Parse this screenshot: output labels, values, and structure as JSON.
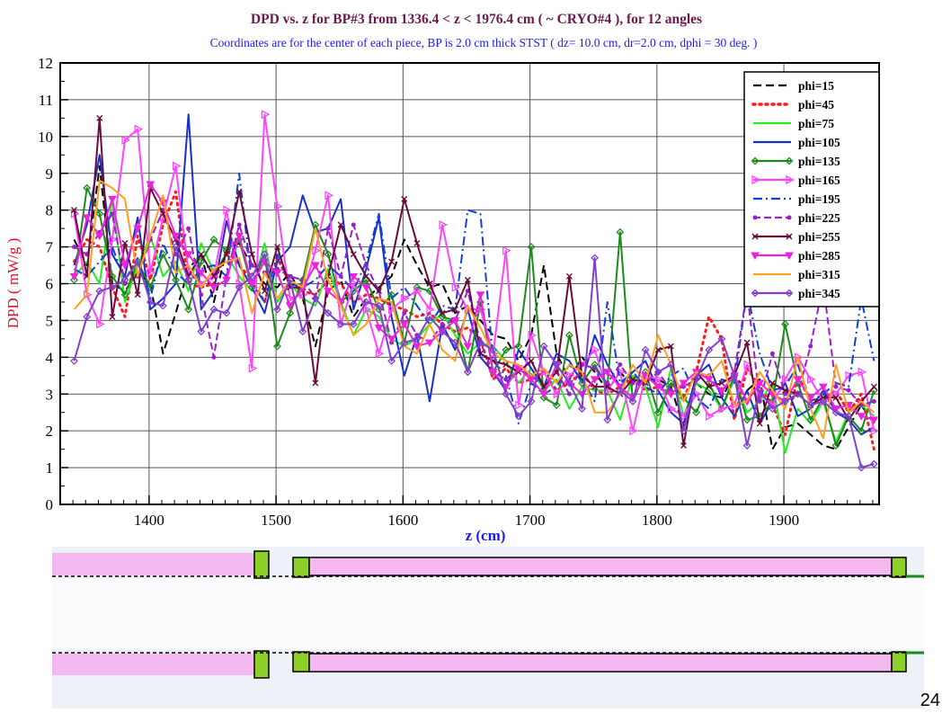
{
  "slide_number": "24",
  "colors": {
    "title": "#6b1a4a",
    "subtitle": "#1a1aff",
    "ylabel": "#e0102a",
    "xlabel": "#1a1aff",
    "geometry_pink": "#f4b8f0",
    "geometry_green": "#8fcf2a",
    "geometry_bg": "#eef1f7"
  },
  "chart_data": {
    "type": "line",
    "title": "DPD vs. z   for  BP#3  from 1336.4 < z < 1976.4 cm ( ~ CRYO#4 ), for 12 angles",
    "subtitle": "Coordinates are for the center of each piece, BP is 2.0 cm thick STST  ( dz= 10.0 cm, dr=2.0 cm, dphi = 30 deg. )",
    "xlabel": "z (cm)",
    "ylabel": "DPD ( mW/g )",
    "xlim": [
      1330,
      1975
    ],
    "ylim": [
      0,
      12
    ],
    "xticks": [
      1400,
      1500,
      1600,
      1700,
      1800,
      1900
    ],
    "yticks": [
      0,
      1,
      2,
      3,
      4,
      5,
      6,
      7,
      8,
      9,
      10,
      11,
      12
    ],
    "grid": true,
    "legend_position": "top-right",
    "x": [
      1341,
      1351,
      1361,
      1371,
      1381,
      1391,
      1401,
      1411,
      1421,
      1431,
      1441,
      1451,
      1461,
      1471,
      1481,
      1491,
      1501,
      1511,
      1521,
      1531,
      1541,
      1551,
      1561,
      1571,
      1581,
      1591,
      1601,
      1611,
      1621,
      1631,
      1641,
      1651,
      1661,
      1671,
      1681,
      1691,
      1701,
      1711,
      1721,
      1731,
      1741,
      1751,
      1761,
      1771,
      1781,
      1791,
      1801,
      1811,
      1821,
      1831,
      1841,
      1851,
      1861,
      1871,
      1881,
      1891,
      1901,
      1911,
      1921,
      1931,
      1941,
      1951,
      1961,
      1971
    ],
    "series": [
      {
        "name": "phi=15",
        "color": "#000000",
        "dash": "9,5",
        "marker": "none",
        "values": [
          7.2,
          6.5,
          9.2,
          6.0,
          5.8,
          6.3,
          6.0,
          4.1,
          5.2,
          6.4,
          6.8,
          5.5,
          6.9,
          7.1,
          6.5,
          6.0,
          5.9,
          6.3,
          5.6,
          4.3,
          5.8,
          6.1,
          5.1,
          5.6,
          5.9,
          6.2,
          7.2,
          6.5,
          5.9,
          6.0,
          5.2,
          5.4,
          5.0,
          4.6,
          4.5,
          3.9,
          4.6,
          6.5,
          4.1,
          3.4,
          4.0,
          3.6,
          3.1,
          3.6,
          3.2,
          3.4,
          3.4,
          3.2,
          2.1,
          3.3,
          3.0,
          2.9,
          3.5,
          3.1,
          3.4,
          1.5,
          2.1,
          2.2,
          1.9,
          1.6,
          1.5,
          2.1,
          2.7,
          2.2
        ]
      },
      {
        "name": "phi=45",
        "color": "#ff1a1a",
        "dash": "2,5",
        "marker": "none",
        "values": [
          6.6,
          7.2,
          7.0,
          5.9,
          5.1,
          7.3,
          6.1,
          7.6,
          8.5,
          6.0,
          5.9,
          6.0,
          6.9,
          6.5,
          6.1,
          5.5,
          6.7,
          6.0,
          5.8,
          5.7,
          6.1,
          6.0,
          5.5,
          5.7,
          5.6,
          5.4,
          5.3,
          5.1,
          5.2,
          4.9,
          4.7,
          4.8,
          4.5,
          3.4,
          3.7,
          3.3,
          3.4,
          3.6,
          3.1,
          3.3,
          3.6,
          3.1,
          3.0,
          3.2,
          3.4,
          3.1,
          3.2,
          3.3,
          2.9,
          3.6,
          5.1,
          4.5,
          2.3,
          3.7,
          3.2,
          2.7,
          1.9,
          3.5,
          2.8,
          2.9,
          3.1,
          2.5,
          3.0,
          1.5
        ]
      },
      {
        "name": "phi=75",
        "color": "#22ee22",
        "dash": "",
        "marker": "none",
        "values": [
          6.2,
          6.6,
          6.0,
          8.3,
          5.5,
          6.5,
          7.3,
          6.2,
          6.6,
          5.8,
          7.1,
          6.3,
          6.8,
          6.2,
          5.8,
          7.1,
          5.5,
          6.0,
          5.6,
          5.4,
          6.4,
          5.5,
          4.6,
          5.3,
          5.1,
          4.5,
          4.3,
          4.5,
          4.9,
          5.2,
          4.6,
          4.1,
          4.4,
          4.3,
          3.9,
          3.3,
          3.7,
          3.1,
          3.4,
          2.6,
          3.2,
          3.1,
          3.1,
          2.3,
          3.5,
          3.2,
          2.1,
          3.7,
          2.4,
          3.3,
          3.1,
          2.6,
          3.4,
          2.5,
          2.8,
          3.3,
          1.4,
          2.6,
          2.2,
          2.8,
          1.7,
          2.5,
          2.7,
          2.4
        ]
      },
      {
        "name": "phi=105",
        "color": "#1530cc",
        "dash": "",
        "marker": "none",
        "values": [
          6.5,
          7.6,
          9.5,
          6.8,
          6.2,
          7.8,
          5.3,
          5.6,
          6.0,
          10.6,
          5.3,
          5.8,
          7.7,
          6.5,
          5.9,
          5.2,
          6.6,
          7.0,
          8.4,
          7.4,
          7.5,
          8.3,
          5.3,
          6.4,
          7.8,
          5.1,
          3.5,
          4.6,
          2.8,
          4.9,
          4.2,
          5.3,
          4.0,
          3.6,
          3.1,
          4.2,
          3.7,
          3.2,
          4.1,
          3.9,
          3.3,
          4.6,
          3.8,
          3.2,
          3.6,
          3.9,
          3.1,
          2.5,
          2.2,
          3.5,
          3.8,
          2.9,
          2.4,
          3.1,
          2.2,
          2.8,
          3.3,
          2.4,
          2.6,
          3.1,
          2.5,
          2.3,
          1.9,
          2.1
        ]
      },
      {
        "name": "phi=135",
        "color": "#1d8a1d",
        "dash": "",
        "marker": "diamond",
        "values": [
          6.1,
          8.6,
          7.9,
          6.2,
          5.7,
          6.6,
          5.9,
          6.8,
          6.1,
          5.3,
          6.6,
          7.2,
          6.9,
          7.2,
          5.9,
          6.8,
          4.3,
          5.2,
          6.1,
          7.6,
          6.8,
          5.5,
          5.8,
          6.1,
          5.3,
          5.7,
          4.4,
          5.9,
          5.8,
          5.1,
          5.0,
          3.6,
          5.5,
          3.6,
          4.2,
          4.3,
          7.0,
          2.9,
          2.7,
          4.6,
          3.3,
          3.8,
          3.2,
          7.4,
          2.8,
          3.6,
          2.5,
          3.3,
          2.9,
          2.5,
          3.3,
          2.6,
          3.5,
          2.3,
          2.4,
          2.8,
          4.9,
          3.3,
          2.3,
          2.9,
          1.6,
          2.4,
          2.0,
          3.1
        ]
      },
      {
        "name": "phi=165",
        "color": "#ff44ff",
        "dash": "",
        "marker": "tri",
        "values": [
          7.9,
          5.7,
          4.9,
          7.2,
          9.9,
          10.2,
          6.3,
          7.8,
          9.2,
          6.3,
          6.0,
          6.2,
          8.0,
          6.0,
          3.7,
          10.6,
          8.1,
          5.6,
          5.7,
          6.9,
          8.4,
          4.9,
          6.0,
          5.3,
          4.1,
          5.3,
          5.6,
          5.8,
          5.3,
          7.6,
          5.9,
          5.3,
          5.3,
          4.1,
          6.9,
          2.7,
          4.6,
          3.6,
          3.0,
          3.5,
          3.8,
          4.2,
          3.1,
          3.6,
          2.0,
          3.5,
          3.4,
          2.6,
          2.4,
          3.0,
          2.4,
          2.6,
          2.7,
          3.8,
          3.0,
          2.7,
          3.4,
          4.0,
          3.4,
          2.8,
          3.0,
          3.5,
          3.6,
          2.0
        ]
      },
      {
        "name": "phi=195",
        "color": "#1040dd",
        "dash": "10,4,2,4",
        "marker": "none",
        "values": [
          6.4,
          6.2,
          6.6,
          7.0,
          6.1,
          6.7,
          5.6,
          7.1,
          6.3,
          6.0,
          6.4,
          6.5,
          6.2,
          9.0,
          6.0,
          5.5,
          6.8,
          6.0,
          5.9,
          6.1,
          6.5,
          6.2,
          5.8,
          6.6,
          7.9,
          5.6,
          5.9,
          5.4,
          4.9,
          5.4,
          5.3,
          8.0,
          7.9,
          3.9,
          3.5,
          2.2,
          3.3,
          3.0,
          3.2,
          3.8,
          3.4,
          2.8,
          5.5,
          3.3,
          3.6,
          3.2,
          3.0,
          3.5,
          3.7,
          2.9,
          2.6,
          3.4,
          3.3,
          5.8,
          4.1,
          3.1,
          3.2,
          3.8,
          2.8,
          3.0,
          3.3,
          3.2,
          5.6,
          3.9
        ]
      },
      {
        "name": "phi=225",
        "color": "#9a20c8",
        "dash": "8,4",
        "marker": "dot",
        "values": [
          7.0,
          6.8,
          7.4,
          7.9,
          6.0,
          6.2,
          7.2,
          8.0,
          6.8,
          7.5,
          5.7,
          4.0,
          6.2,
          7.6,
          6.5,
          6.3,
          6.4,
          6.2,
          6.1,
          5.6,
          7.5,
          6.2,
          7.6,
          6.5,
          5.8,
          4.4,
          5.2,
          4.6,
          4.4,
          4.9,
          5.0,
          5.8,
          4.4,
          3.6,
          3.4,
          3.7,
          3.5,
          3.2,
          3.6,
          3.0,
          3.8,
          3.7,
          3.3,
          3.8,
          3.3,
          3.3,
          3.6,
          3.1,
          3.2,
          3.4,
          3.5,
          3.0,
          3.6,
          5.8,
          2.8,
          4.1,
          3.0,
          3.0,
          4.3,
          6.0,
          3.2,
          3.1,
          2.7,
          2.8
        ]
      },
      {
        "name": "phi=255",
        "color": "#6a0a3a",
        "dash": "",
        "marker": "x",
        "values": [
          8.0,
          6.2,
          10.5,
          5.1,
          7.1,
          5.7,
          8.6,
          7.9,
          7.2,
          6.2,
          6.8,
          6.2,
          6.8,
          8.5,
          6.8,
          5.8,
          7.0,
          5.9,
          5.9,
          3.3,
          6.2,
          7.6,
          6.8,
          6.2,
          5.8,
          6.6,
          8.3,
          7.1,
          6.0,
          5.2,
          5.3,
          6.1,
          4.1,
          3.9,
          3.8,
          3.6,
          3.9,
          3.2,
          3.6,
          6.2,
          3.5,
          3.2,
          3.2,
          3.0,
          3.4,
          3.3,
          4.2,
          4.3,
          1.6,
          3.6,
          3.2,
          3.3,
          3.5,
          4.4,
          2.2,
          3.3,
          3.1,
          3.0,
          2.7,
          2.9,
          2.9,
          2.3,
          2.8,
          3.2
        ]
      },
      {
        "name": "phi=285",
        "color": "#ee22dd",
        "dash": "",
        "marker": "tridown",
        "values": [
          6.2,
          7.8,
          7.3,
          8.3,
          6.5,
          7.5,
          8.7,
          8.2,
          7.3,
          6.8,
          6.3,
          5.9,
          6.1,
          7.3,
          6.0,
          6.6,
          6.3,
          5.4,
          5.9,
          6.5,
          5.8,
          5.5,
          6.2,
          5.9,
          4.8,
          4.5,
          4.9,
          4.3,
          4.4,
          4.7,
          5.0,
          4.3,
          5.7,
          3.6,
          3.2,
          3.7,
          3.4,
          3.0,
          3.8,
          3.3,
          3.0,
          3.4,
          3.6,
          3.2,
          2.9,
          3.5,
          3.2,
          3.0,
          3.3,
          3.6,
          3.4,
          3.1,
          3.5,
          2.8,
          3.3,
          3.0,
          2.8,
          3.4,
          2.9,
          3.2,
          2.6,
          2.7,
          2.4,
          2.3
        ]
      },
      {
        "name": "phi=315",
        "color": "#ffa020",
        "dash": "",
        "marker": "none",
        "values": [
          5.3,
          5.7,
          8.8,
          8.6,
          8.3,
          6.2,
          7.3,
          8.4,
          6.3,
          6.5,
          5.9,
          6.4,
          6.6,
          6.7,
          5.2,
          6.3,
          5.6,
          6.1,
          5.9,
          7.5,
          6.1,
          5.4,
          4.6,
          4.9,
          5.6,
          5.5,
          4.3,
          4.1,
          4.9,
          4.2,
          3.9,
          5.4,
          4.8,
          4.1,
          3.9,
          3.8,
          3.5,
          3.7,
          3.3,
          3.8,
          3.6,
          2.5,
          2.5,
          3.0,
          3.8,
          3.3,
          4.6,
          3.8,
          2.8,
          3.6,
          3.5,
          3.9,
          2.7,
          2.8,
          3.6,
          3.1,
          2.6,
          4.0,
          2.6,
          1.8,
          3.8,
          2.5,
          2.8,
          2.5
        ]
      },
      {
        "name": "phi=345",
        "color": "#8040cc",
        "dash": "",
        "marker": "diamond",
        "values": [
          3.9,
          5.1,
          5.8,
          5.9,
          6.1,
          6.6,
          5.5,
          5.4,
          7.0,
          6.1,
          4.7,
          5.3,
          5.2,
          5.9,
          6.2,
          6.8,
          5.3,
          6.1,
          4.7,
          5.6,
          5.2,
          4.9,
          4.9,
          5.5,
          5.4,
          3.9,
          4.4,
          4.5,
          5.1,
          4.7,
          4.4,
          3.6,
          4.4,
          4.2,
          3.0,
          2.4,
          2.8,
          4.3,
          3.8,
          3.3,
          2.6,
          6.7,
          2.3,
          3.1,
          2.8,
          4.2,
          3.6,
          3.8,
          2.0,
          3.4,
          4.2,
          4.5,
          3.5,
          1.6,
          3.1,
          2.6,
          2.8,
          3.0,
          2.7,
          2.8,
          2.5,
          2.4,
          1.0,
          1.1
        ]
      }
    ]
  }
}
